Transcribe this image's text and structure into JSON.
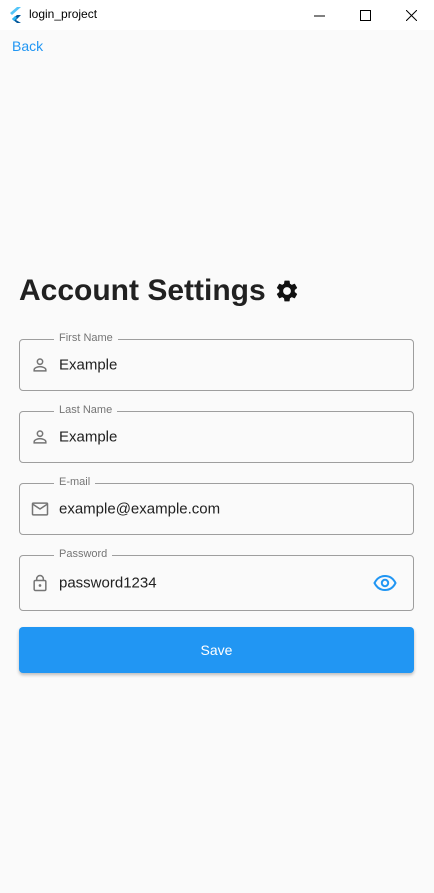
{
  "window": {
    "title": "login_project"
  },
  "nav": {
    "back_label": "Back"
  },
  "page": {
    "title": "Account Settings"
  },
  "fields": [
    {
      "label": "First Name",
      "value": "Example"
    },
    {
      "label": "Last Name",
      "value": "Example"
    },
    {
      "label": "E-mail",
      "value": "example@example.com"
    },
    {
      "label": "Password",
      "value": "password1234"
    }
  ],
  "actions": {
    "save_label": "Save"
  },
  "colors": {
    "accent": "#2196F3"
  }
}
